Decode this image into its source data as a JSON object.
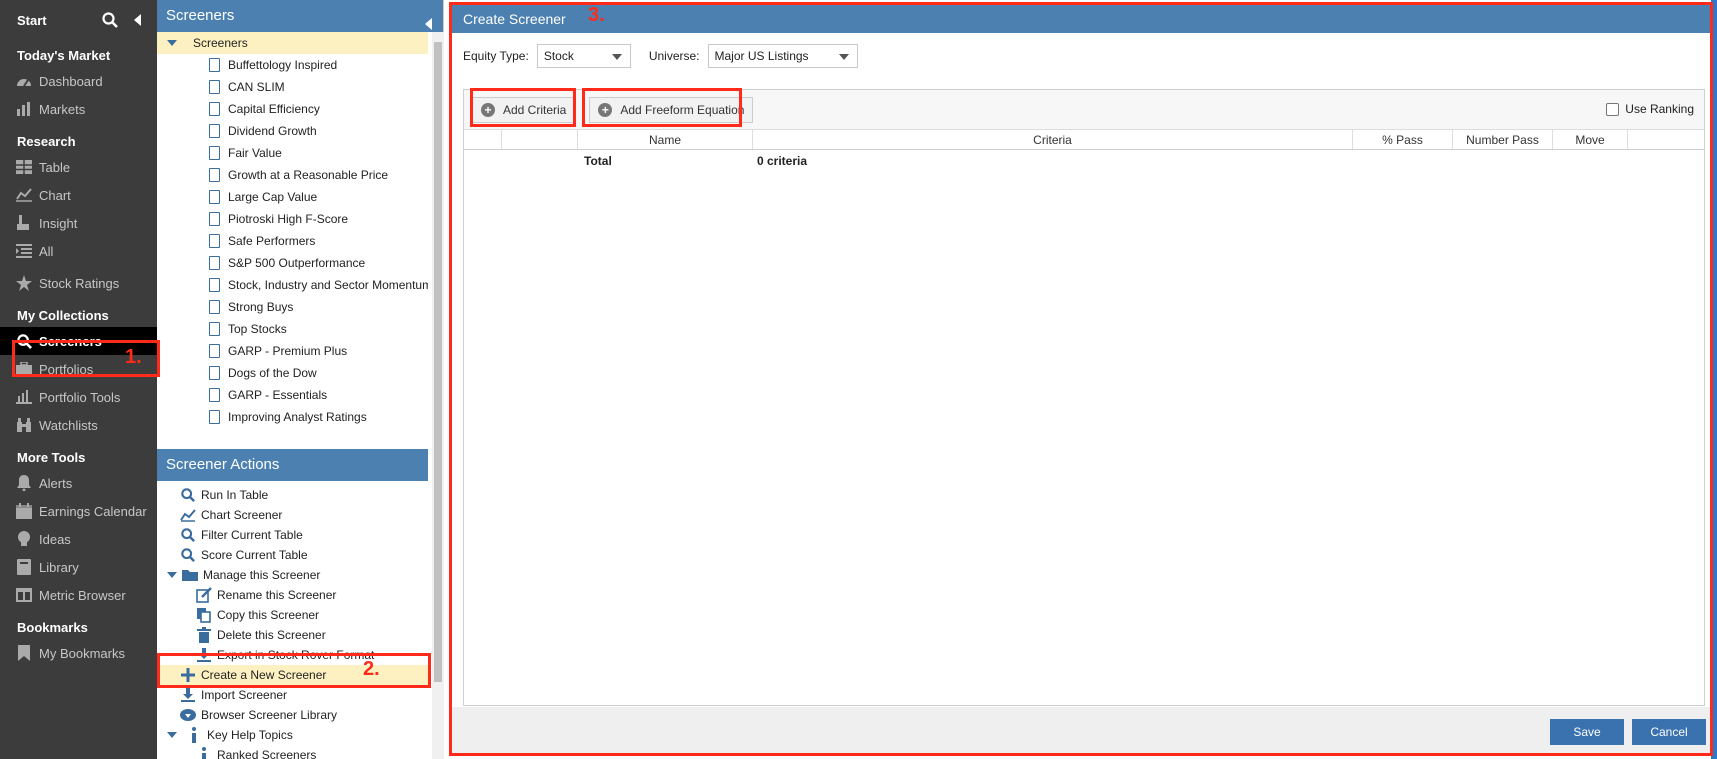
{
  "nav": {
    "start": "Start",
    "sections": [
      {
        "title": "Today's Market",
        "items": [
          {
            "label": "Dashboard",
            "icon": "gauge-icon"
          },
          {
            "label": "Markets",
            "icon": "bar-chart-icon"
          }
        ]
      },
      {
        "title": "Research",
        "items": [
          {
            "label": "Table",
            "icon": "table-icon"
          },
          {
            "label": "Chart",
            "icon": "line-chart-icon"
          },
          {
            "label": "Insight",
            "icon": "insight-icon"
          },
          {
            "label": "All",
            "icon": "list-icon"
          },
          {
            "label": "Stock Ratings",
            "icon": "star-icon"
          }
        ]
      },
      {
        "title": "My Collections",
        "items": [
          {
            "label": "Screeners",
            "icon": "search-icon",
            "active": true
          },
          {
            "label": "Portfolios",
            "icon": "briefcase-icon"
          },
          {
            "label": "Portfolio Tools",
            "icon": "tools-chart-icon"
          },
          {
            "label": "Watchlists",
            "icon": "binoculars-icon"
          }
        ]
      },
      {
        "title": "More Tools",
        "items": [
          {
            "label": "Alerts",
            "icon": "bell-icon"
          },
          {
            "label": "Earnings Calendar",
            "icon": "calendar-icon"
          },
          {
            "label": "Ideas",
            "icon": "bulb-icon"
          },
          {
            "label": "Library",
            "icon": "book-icon"
          },
          {
            "label": "Metric Browser",
            "icon": "browser-icon"
          }
        ]
      },
      {
        "title": "Bookmarks",
        "items": [
          {
            "label": "My Bookmarks",
            "icon": "bookmark-icon"
          }
        ]
      }
    ]
  },
  "annotations": {
    "one": "1.",
    "two": "2.",
    "three": "3."
  },
  "tree": {
    "header": "Screeners",
    "root": "Screeners",
    "items": [
      "Buffettology Inspired",
      "CAN SLIM",
      "Capital Efficiency",
      "Dividend Growth",
      "Fair Value",
      "Growth at a Reasonable Price",
      "Large Cap Value",
      "Piotroski High F-Score",
      "Safe Performers",
      "S&P 500 Outperformance",
      "Stock, Industry and Sector Momentum",
      "Strong Buys",
      "Top Stocks",
      "GARP - Premium Plus",
      "Dogs of the Dow",
      "GARP - Essentials",
      "Improving Analyst Ratings"
    ]
  },
  "actions": {
    "header": "Screener Actions",
    "run_in_table": "Run In Table",
    "chart_screener": "Chart Screener",
    "filter_current_table": "Filter Current Table",
    "score_current_table": "Score Current Table",
    "manage": "Manage this Screener",
    "rename": "Rename this Screener",
    "copy": "Copy this Screener",
    "delete": "Delete this Screener",
    "export": "Export in Stock Rover Format",
    "create_new": "Create a New Screener",
    "import": "Import Screener",
    "browse_library": "Browser Screener Library",
    "key_help": "Key Help Topics",
    "ranked": "Ranked Screeners"
  },
  "main": {
    "title": "Create Screener",
    "equity_type_label": "Equity Type:",
    "equity_type_value": "Stock",
    "universe_label": "Universe:",
    "universe_value": "Major US Listings",
    "add_criteria": "Add Criteria",
    "add_freeform": "Add Freeform Equation",
    "use_ranking": "Use Ranking",
    "columns": [
      "Name",
      "Criteria",
      "% Pass",
      "Number Pass",
      "Move"
    ],
    "total_label": "Total",
    "total_criteria": "0 criteria",
    "save": "Save",
    "cancel": "Cancel"
  }
}
